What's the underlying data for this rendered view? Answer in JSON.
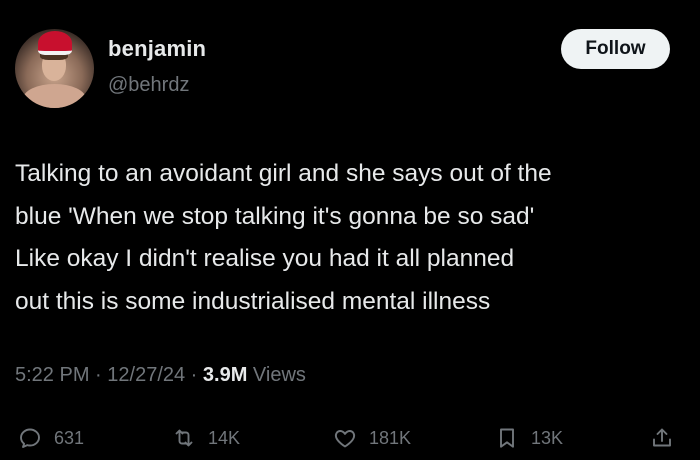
{
  "author": {
    "display_name": "benjamin",
    "handle": "@behrdz"
  },
  "follow_button": {
    "label": "Follow"
  },
  "tweet": {
    "lines": [
      "Talking to an avoidant girl and she says out of the",
      "blue 'When we stop talking it's gonna be so sad'",
      "Like okay I didn't realise you had it all planned",
      "out this is some industrialised mental illness"
    ]
  },
  "meta": {
    "time": "5:22 PM",
    "separator": " · ",
    "date": "12/27/24",
    "views_count": "3.9M",
    "views_label": " Views"
  },
  "actions": {
    "replies": {
      "icon": "reply-icon",
      "count": "631"
    },
    "reposts": {
      "icon": "repost-icon",
      "count": "14K"
    },
    "likes": {
      "icon": "heart-icon",
      "count": "181K"
    },
    "bookmarks": {
      "icon": "bookmark-icon",
      "count": "13K"
    },
    "share": {
      "icon": "share-icon"
    }
  },
  "colors": {
    "background": "#000000",
    "text_primary": "#e7e9ea",
    "text_secondary": "#71767b",
    "follow_bg": "#eff3f4"
  }
}
